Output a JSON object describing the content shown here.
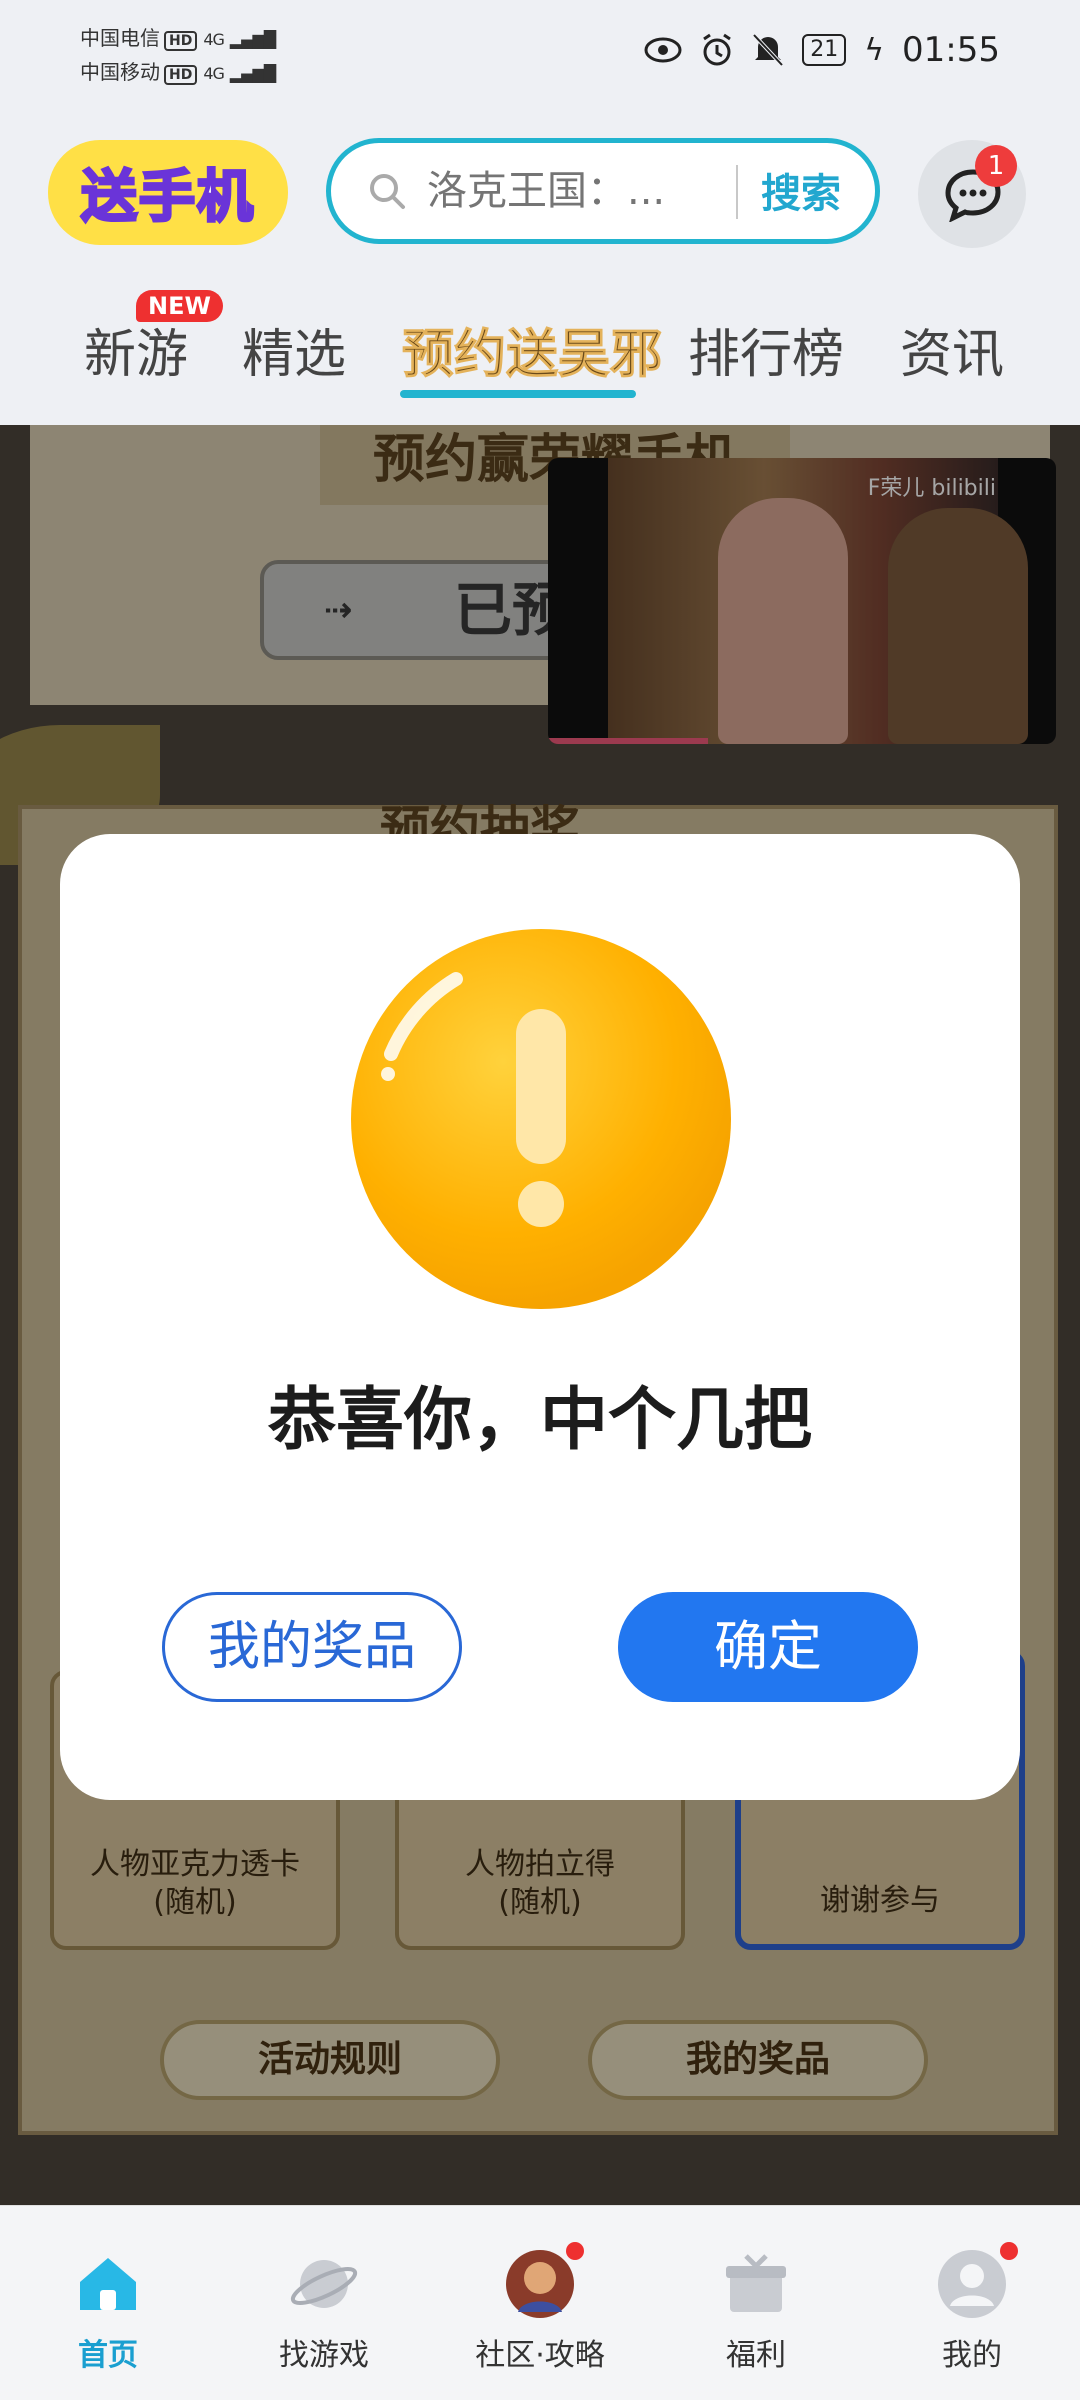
{
  "status_bar": {
    "carrier1": "中国电信",
    "carrier2": "中国移动",
    "hd": "HD",
    "network": "4G",
    "battery": "21",
    "time": "01:55"
  },
  "header": {
    "logo_text": "送手机",
    "search_placeholder": "洛克王国：...",
    "search_button": "搜索",
    "message_badge": "1"
  },
  "tabs": {
    "new_badge": "NEW",
    "items": [
      "新游",
      "精选",
      "预约送吴邪",
      "排行榜",
      "资讯"
    ],
    "active_index": 2
  },
  "background_page": {
    "top_banner": "预约赢荣耀手机",
    "reserved_label": "已预",
    "board_title": "预约抽奖",
    "prizes": [
      {
        "label_line1": "人物亚克力透卡",
        "label_line2": "(随机)"
      },
      {
        "label_line1": "人物拍立得",
        "label_line2": "(随机)"
      },
      {
        "label_line1": "谢谢参与",
        "label_line2": ""
      }
    ],
    "rules_button": "活动规则",
    "my_prizes_button": "我的奖品"
  },
  "video": {
    "watermark": "F荣儿 bilibili"
  },
  "modal": {
    "title": "恭喜你，中个几把",
    "secondary_button": "我的奖品",
    "primary_button": "确定",
    "icon": "exclamation-icon",
    "icon_color": "#ffb300"
  },
  "bottom_nav": {
    "items": [
      "首页",
      "找游戏",
      "社区·攻略",
      "福利",
      "我的"
    ],
    "active_index": 0,
    "accent_color": "#1a9fd0"
  }
}
